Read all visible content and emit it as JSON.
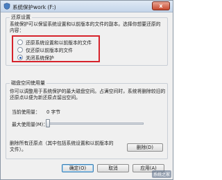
{
  "window": {
    "title": "系统保护work (F:)",
    "close_label": "x"
  },
  "restore_settings": {
    "group_label": "还原设置",
    "description": "系统保护可以保留系统设置和以前版本的文件的副本。选择你想要还原的内容：",
    "options": [
      {
        "label": "还原系统设置和以前版本的文件",
        "checked": false
      },
      {
        "label": "仅还原以前版本的文件",
        "checked": false
      },
      {
        "label": "关闭系统保护",
        "checked": true
      }
    ]
  },
  "disk_usage": {
    "group_label": "磁盘空间使用量",
    "description": "你可以调整用于系统保护的最大磁盘空间。占满空间时，系统将删除较旧的还原点以便为新还原点留出空间。",
    "current_usage_label": "当前使用量：",
    "current_usage_value": "0 字节",
    "max_usage_label": "最大使用量(M)：",
    "max_usage_fraction": 0.0,
    "delete_text": "删除所有还原点（其中包括系统设置和以前版本的文件）。",
    "delete_button_label": "删除(D)"
  },
  "footer": {
    "ok_label": "确定(O)",
    "cancel_label": "取消",
    "apply_label": "应用(A)"
  },
  "watermark_text": "系统之家",
  "colors": {
    "highlight_border": "#d6222a",
    "window_bg": "#f0f0f0"
  }
}
